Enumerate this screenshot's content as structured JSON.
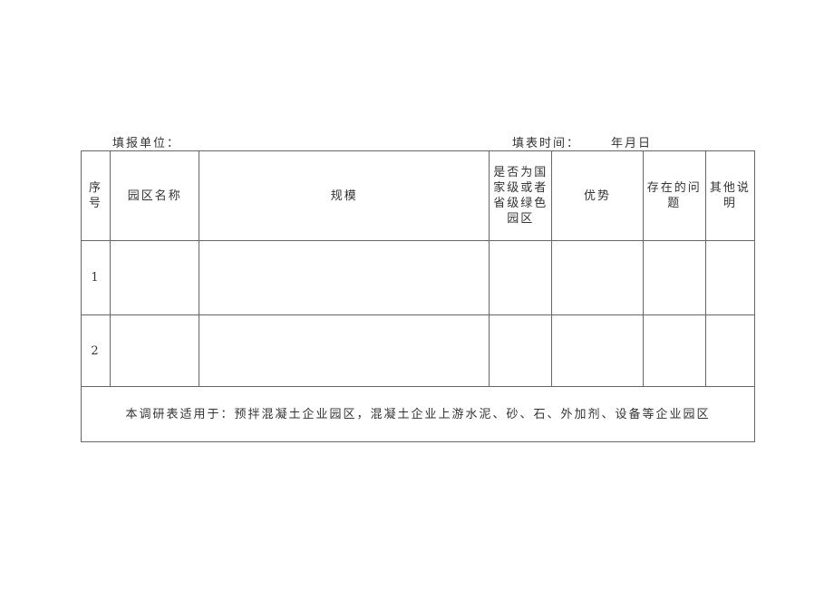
{
  "header": {
    "unit_label": "填报单位：",
    "time_label": "填表时间：",
    "date_label": "年月日"
  },
  "table": {
    "columns": [
      {
        "key": "seq",
        "label": "序号"
      },
      {
        "key": "name",
        "label": "园区名称"
      },
      {
        "key": "scale",
        "label": "规模"
      },
      {
        "key": "green",
        "label": "是否为国家级或者省级绿色园区"
      },
      {
        "key": "advantage",
        "label": "优势"
      },
      {
        "key": "problems",
        "label": "存在的问题"
      },
      {
        "key": "other",
        "label": "其他说明"
      }
    ],
    "rows": [
      {
        "seq": "1",
        "name": "",
        "scale": "",
        "green": "",
        "advantage": "",
        "problems": "",
        "other": ""
      },
      {
        "seq": "2",
        "name": "",
        "scale": "",
        "green": "",
        "advantage": "",
        "problems": "",
        "other": ""
      }
    ],
    "note": "本调研表适用于：预拌混凝土企业园区，混凝土企业上游水泥、砂、石、外加剂、设备等企业园区"
  }
}
